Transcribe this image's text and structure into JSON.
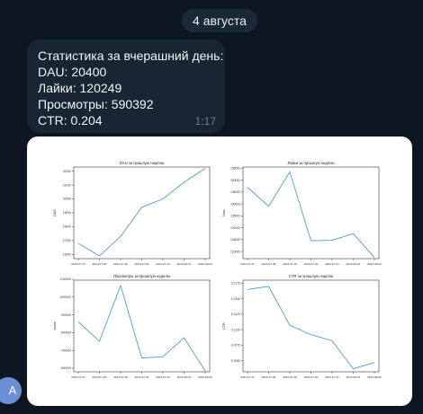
{
  "date_separator": "4 августа",
  "message": {
    "lines": [
      "Статистика за вчерашний день:",
      "DAU: 20400",
      "Лайки: 120249",
      "Просмотры: 590392",
      "CTR: 0.204"
    ],
    "time": "1:17"
  },
  "avatar": {
    "letter": "A",
    "color": "#6a8fd6"
  },
  "colors": {
    "background": "#0e1621",
    "bubble": "#182533",
    "line": "#4e9dd1"
  },
  "chart_data": [
    {
      "type": "line",
      "title": "DAU за прошлую неделю",
      "xlabel": "",
      "ylabel": "DAU",
      "categories": [
        "2023-07-27",
        "2023-07-28",
        "2023-07-29",
        "2023-07-30",
        "2023-07-31",
        "2023-08-01",
        "2023-08-02"
      ],
      "values": [
        16800,
        15900,
        17300,
        19400,
        20000,
        21200,
        22200
      ],
      "yticks": [
        "16000",
        "17000",
        "18000",
        "19000",
        "20000",
        "21000",
        "22000"
      ],
      "ylim": [
        15700,
        22300
      ]
    },
    {
      "type": "line",
      "title": "Лайки за прошлую неделю",
      "xlabel": "",
      "ylabel": "likes",
      "categories": [
        "2023-07-27",
        "2023-07-28",
        "2023-07-29",
        "2023-07-30",
        "2023-07-31",
        "2023-08-01",
        "2023-08-02"
      ],
      "values": [
        147000,
        139000,
        153500,
        124500,
        124700,
        127500,
        117500
      ],
      "yticks": [
        "120000",
        "125000",
        "130000",
        "135000",
        "140000",
        "145000",
        "150000",
        "155000"
      ],
      "ylim": [
        117000,
        155500
      ]
    },
    {
      "type": "line",
      "title": "Просмотры за прошлую неделю",
      "xlabel": "",
      "ylabel": "views",
      "categories": [
        "2023-07-27",
        "2023-07-28",
        "2023-07-29",
        "2023-07-30",
        "2023-07-31",
        "2023-08-01",
        "2023-08-02"
      ],
      "values": [
        860000,
        752000,
        1065000,
        658000,
        665000,
        771000,
        585000
      ],
      "yticks": [
        "600000",
        "700000",
        "800000",
        "900000",
        "1000000",
        "1100000"
      ],
      "ylim": [
        580000,
        1095000
      ]
    },
    {
      "type": "line",
      "title": "CTR за прошлую неделю",
      "xlabel": "",
      "ylabel": "CTR",
      "categories": [
        "2023-07-27",
        "2023-07-28",
        "2023-07-29",
        "2023-07-30",
        "2023-07-31",
        "2023-08-01",
        "2023-08-02"
      ],
      "values": [
        0.2165,
        0.217,
        0.2107,
        0.2092,
        0.2082,
        0.2037,
        0.2047
      ],
      "yticks": [
        "0.2050",
        "0.2075",
        "0.2100",
        "0.2125",
        "0.2150",
        "0.2175"
      ],
      "ylim": [
        0.2032,
        0.218
      ]
    }
  ]
}
